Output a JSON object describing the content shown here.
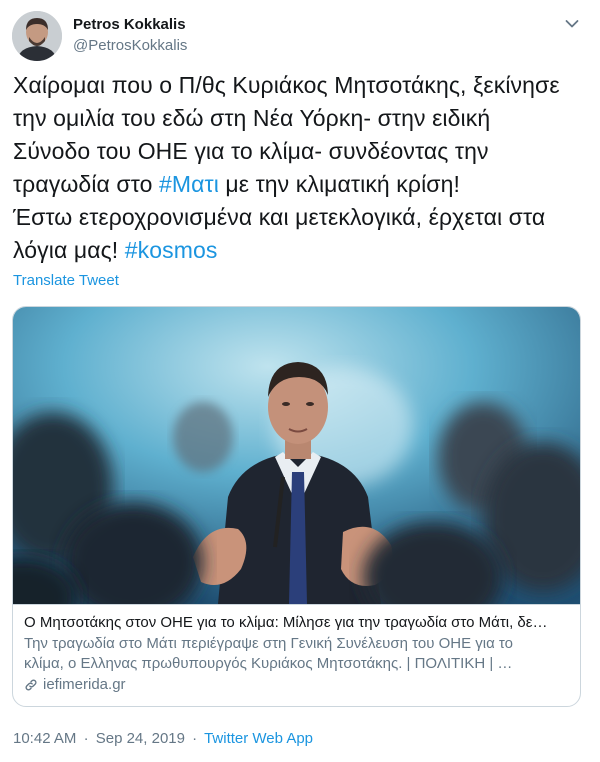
{
  "author": {
    "name": "Petros Kokkalis",
    "handle": "@PetrosKokkalis"
  },
  "tweet": {
    "lines": [
      [
        {
          "t": "Χαίρομαι που ο Π/θς Κυριάκος Μητσοτάκης, ξεκίνησε",
          "h": false
        }
      ],
      [
        {
          "t": "την ομιλία του εδώ στη Νέα Υόρκη- στην ειδική",
          "h": false
        }
      ],
      [
        {
          "t": "Σύνοδο του ΟΗΕ για το κλίμα- συνδέοντας την",
          "h": false
        }
      ],
      [
        {
          "t": "τραγωδία στο ",
          "h": false
        },
        {
          "t": "#Ματι",
          "h": true
        },
        {
          "t": " με την κλιματική κρίση!",
          "h": false
        }
      ],
      [
        {
          "t": "Έστω ετεροχρονισμένα και μετεκλογικά, έρχεται στα",
          "h": false
        }
      ],
      [
        {
          "t": "λόγια μας! ",
          "h": false
        },
        {
          "t": "#kosmos",
          "h": true
        }
      ]
    ]
  },
  "translate_label": "Translate Tweet",
  "card": {
    "title": "Ο Μητσοτάκης στον ΟΗΕ για το κλίμα: Μίλησε για την τραγωδία στο Μάτι, δε…",
    "description_line1": "Την τραγωδία στο Μάτι περιέγραψε στη Γενική Συνέλευση του ΟΗΕ για το",
    "description_line2": "κλίμα, ο Ελληνας πρωθυπουργός Κυριάκος Μητσοτάκης. | ΠΟΛΙΤΙΚΗ | …",
    "domain": "iefimerida.gr"
  },
  "meta": {
    "time": "10:42 AM",
    "separator": "·",
    "date": "Sep 24, 2019",
    "source": "Twitter Web App"
  },
  "colors": {
    "link": "#1b95e0",
    "secondary_text": "#657786",
    "primary_text": "#14171a",
    "border": "#ccd6dd"
  },
  "icons": {
    "caret": "chevron-down-icon",
    "link": "link-icon"
  }
}
